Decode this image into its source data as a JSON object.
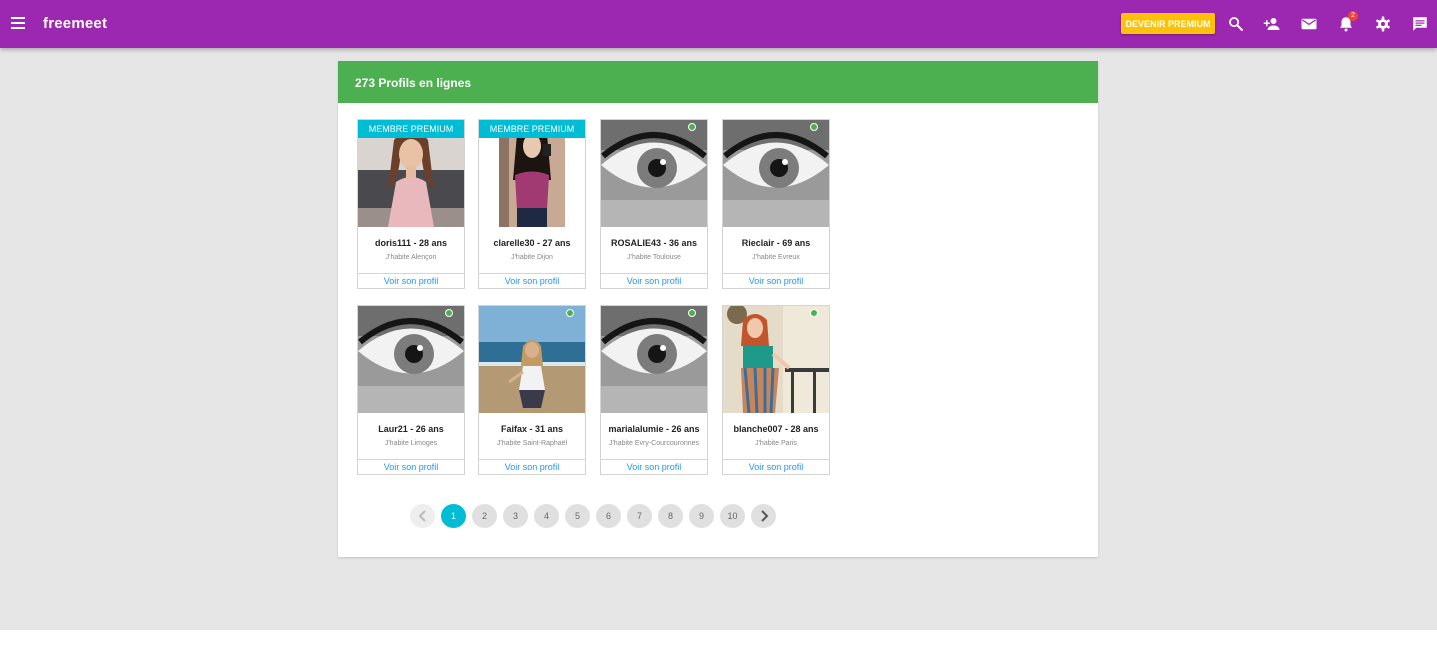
{
  "app": {
    "brand": "freemeet"
  },
  "header": {
    "premium_label": "DEVENIR PREMIUM",
    "notification_count": "2",
    "colors": {
      "bar": "#9c27b0",
      "premium": "#ffc107",
      "badge": "#f44336"
    },
    "icons": [
      "menu-icon",
      "search-icon",
      "add-person-icon",
      "mail-icon",
      "bell-icon",
      "gear-icon",
      "chat-icon"
    ]
  },
  "panel": {
    "title": "273 Profils en lignes",
    "colors": {
      "header": "#4caf50",
      "ribbon": "#00bcd4",
      "link": "#2196f3"
    }
  },
  "profiles": [
    {
      "name": "doris111 - 28 ans",
      "city": "J'habite Alençon",
      "premium": "MEMBRE PREMIUM",
      "link": "Voir son profil",
      "photo": "woman-pink-top"
    },
    {
      "name": "clarelle30 - 27 ans",
      "city": "J'habite Dijon",
      "premium": "MEMBRE PREMIUM",
      "link": "Voir son profil",
      "photo": "woman-selfie"
    },
    {
      "name": "ROSALIE43 - 36 ans",
      "city": "J'habite Toulouse",
      "link": "Voir son profil",
      "photo": "eye-placeholder",
      "online": true
    },
    {
      "name": "Rieclair - 69 ans",
      "city": "J'habite Evreux",
      "link": "Voir son profil",
      "photo": "eye-placeholder",
      "online": true
    },
    {
      "name": "Laur21 - 26 ans",
      "city": "J'habite Limoges",
      "link": "Voir son profil",
      "photo": "eye-placeholder",
      "online": true
    },
    {
      "name": "Faifax - 31 ans",
      "city": "J'habite Saint-Raphaël",
      "link": "Voir son profil",
      "photo": "woman-beach",
      "online": true
    },
    {
      "name": "marialalumie - 26 ans",
      "city": "J'habite Evry-Courcouronnes",
      "link": "Voir son profil",
      "photo": "eye-placeholder",
      "online": true
    },
    {
      "name": "blanche007 - 28 ans",
      "city": "J'habite Paris",
      "link": "Voir son profil",
      "photo": "woman-striped-pants",
      "online": true
    }
  ],
  "pagination": {
    "prev_icon": "chevron-left-icon",
    "next_icon": "chevron-right-icon",
    "pages": [
      "1",
      "2",
      "3",
      "4",
      "5",
      "6",
      "7",
      "8",
      "9",
      "10"
    ],
    "current": "1"
  }
}
